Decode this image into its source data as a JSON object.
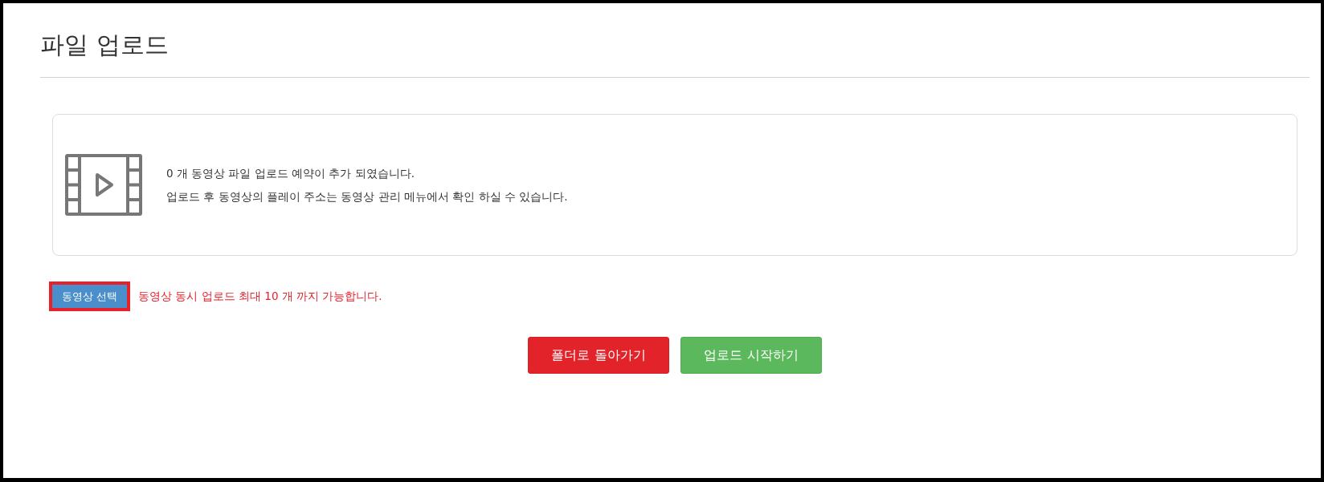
{
  "page": {
    "title": "파일 업로드"
  },
  "upload_panel": {
    "messages": [
      "0 개 동영상 파일 업로드 예약이 추가 되였습니다.",
      "업로드 후 동영상의 플레이 주소는 동영상 관리 메뉴에서 확인 하실 수 있습니다."
    ]
  },
  "file_select": {
    "button": {
      "label": "동영상 선택",
      "highlighted": true
    },
    "notice": "동영상 동시 업로드 최대 10 개 까지 가능합니다."
  },
  "actions": [
    {
      "label": "폴더로 돌아가기",
      "kind": "danger"
    },
    {
      "label": "업로드 시작하기",
      "kind": "success"
    }
  ]
}
